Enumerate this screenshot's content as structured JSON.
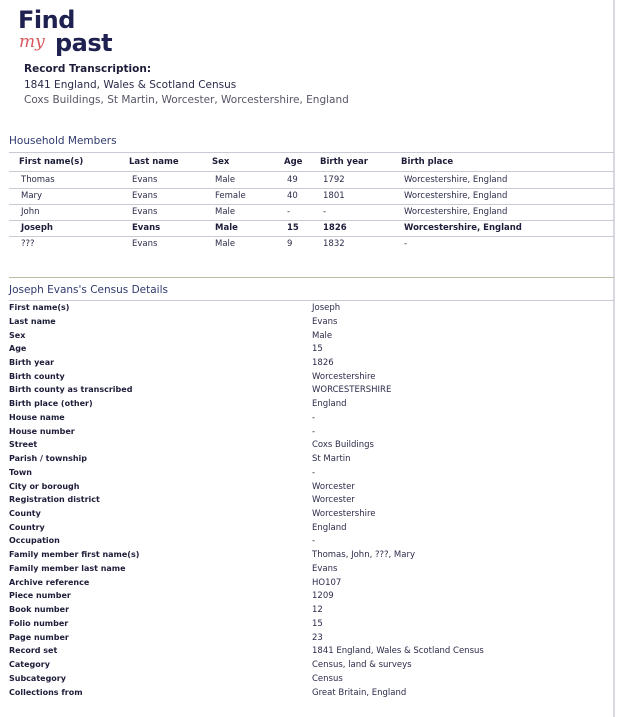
{
  "logo": {
    "find": "Find",
    "my": "my",
    "past": "past"
  },
  "record": {
    "heading": "Record Transcription:",
    "name": "1841 England, Wales & Scotland Census",
    "place": "Coxs Buildings, St Martin, Worcester, Worcestershire, England"
  },
  "household": {
    "title": "Household Members",
    "headers": {
      "first": "First name(s)",
      "last": "Last name",
      "sex": "Sex",
      "age": "Age",
      "birth_year": "Birth year",
      "birth_place": "Birth place"
    },
    "rows": [
      {
        "first": "Thomas",
        "last": "Evans",
        "sex": "Male",
        "age": "49",
        "birth_year": "1792",
        "birth_place": "Worcestershire, England"
      },
      {
        "first": "Mary",
        "last": "Evans",
        "sex": "Female",
        "age": "40",
        "birth_year": "1801",
        "birth_place": "Worcestershire, England"
      },
      {
        "first": "John",
        "last": "Evans",
        "sex": "Male",
        "age": "-",
        "birth_year": "-",
        "birth_place": "Worcestershire, England"
      },
      {
        "first": "Joseph",
        "last": "Evans",
        "sex": "Male",
        "age": "15",
        "birth_year": "1826",
        "birth_place": "Worcestershire, England"
      },
      {
        "first": "???",
        "last": "Evans",
        "sex": "Male",
        "age": "9",
        "birth_year": "1832",
        "birth_place": "-"
      }
    ]
  },
  "details": {
    "title": "Joseph Evans's Census Details",
    "items": [
      {
        "label": "First name(s)",
        "value": "Joseph"
      },
      {
        "label": "Last name",
        "value": "Evans"
      },
      {
        "label": "Sex",
        "value": "Male"
      },
      {
        "label": "Age",
        "value": "15"
      },
      {
        "label": "Birth year",
        "value": "1826"
      },
      {
        "label": "Birth county",
        "value": "Worcestershire"
      },
      {
        "label": "Birth county as transcribed",
        "value": "WORCESTERSHIRE"
      },
      {
        "label": "Birth place (other)",
        "value": "England"
      },
      {
        "label": "House name",
        "value": "-"
      },
      {
        "label": "House number",
        "value": "-"
      },
      {
        "label": "Street",
        "value": "Coxs Buildings"
      },
      {
        "label": "Parish / township",
        "value": "St Martin"
      },
      {
        "label": "Town",
        "value": "-"
      },
      {
        "label": "City or borough",
        "value": "Worcester"
      },
      {
        "label": "Registration district",
        "value": "Worcester"
      },
      {
        "label": "County",
        "value": "Worcestershire"
      },
      {
        "label": "Country",
        "value": "England"
      },
      {
        "label": "Occupation",
        "value": "-"
      },
      {
        "label": "Family member first name(s)",
        "value": "Thomas, John, ???, Mary"
      },
      {
        "label": "Family member last name",
        "value": "Evans"
      },
      {
        "label": "Archive reference",
        "value": "HO107"
      },
      {
        "label": "Piece number",
        "value": "1209"
      },
      {
        "label": "Book number",
        "value": "12"
      },
      {
        "label": "Folio number",
        "value": "15"
      },
      {
        "label": "Page number",
        "value": "23"
      },
      {
        "label": "Record set",
        "value": "1841 England, Wales & Scotland Census"
      },
      {
        "label": "Category",
        "value": "Census, land & surveys"
      },
      {
        "label": "Subcategory",
        "value": "Census"
      },
      {
        "label": "Collections from",
        "value": "Great Britain, England"
      }
    ]
  }
}
